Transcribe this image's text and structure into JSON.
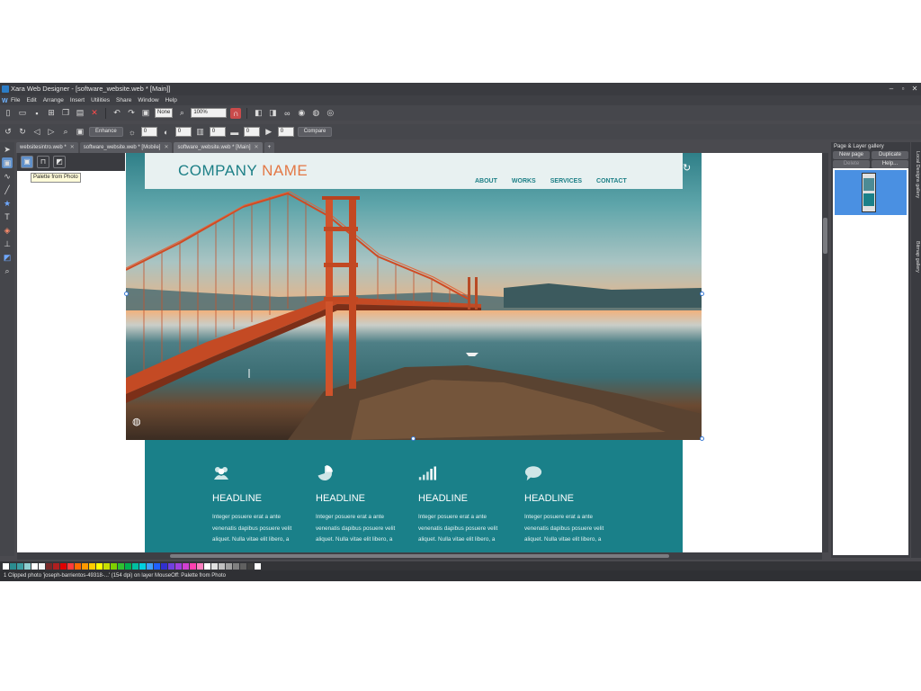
{
  "window": {
    "title": "Xara Web Designer - [software_website.web * [Main]]"
  },
  "menu": [
    "File",
    "Edit",
    "Arrange",
    "Insert",
    "Utilities",
    "Share",
    "Window",
    "Help"
  ],
  "toolbar": {
    "quality_select": "None",
    "zoom_select": "100%",
    "enhance_label": "Enhance",
    "compare_label": "Compare",
    "value_1": "0",
    "value_2": "0",
    "value_3": "0",
    "value_4": "0"
  },
  "tabs": [
    {
      "label": "websitesintro.web *"
    },
    {
      "label": "software_website.web * [Mobile]"
    },
    {
      "label": "software_website.web * [Main]"
    }
  ],
  "photo_tool": {
    "tooltip": "Palette from Photo"
  },
  "site": {
    "company_main": "COMPANY",
    "company_accent": "NAME",
    "nav": [
      "ABOUT",
      "WORKS",
      "SERVICES",
      "CONTACT"
    ],
    "features": [
      {
        "icon": "people-icon",
        "headline": "HEADLINE",
        "text": [
          "Integer posuere erat a ante",
          "venenatis dapibus posuere velit",
          "aliquet. Nulla vitae elit libero, a"
        ]
      },
      {
        "icon": "pie-chart-icon",
        "headline": "HEADLINE",
        "text": [
          "Integer posuere erat a ante",
          "venenatis dapibus posuere velit",
          "aliquet. Nulla vitae elit libero, a"
        ]
      },
      {
        "icon": "bar-chart-icon",
        "headline": "HEADLINE",
        "text": [
          "Integer posuere erat a ante",
          "venenatis dapibus posuere velit",
          "aliquet. Nulla vitae elit libero, a"
        ]
      },
      {
        "icon": "speech-bubble-icon",
        "headline": "HEADLINE",
        "text": [
          "Integer posuere erat a ante",
          "venenatis dapibus posuere velit",
          "aliquet. Nulla vitae elit libero, a"
        ]
      }
    ]
  },
  "gallery": {
    "title": "Page & Layer gallery",
    "new_page": "New page",
    "duplicate": "Duplicate",
    "delete": "Delete",
    "help": "Help...",
    "side_tabs": [
      "Local Designs gallery",
      "Bitmap gallery"
    ]
  },
  "status": "1 Clipped photo 'joseph-barrientos-49318-...' (154 dpi) on layer MouseOff: Palette from Photo",
  "colors": {
    "teal": "#1a8089",
    "accent": "#e37845",
    "swatches": [
      "#ffffff",
      "#2b8c8f",
      "#3c9ea2",
      "#8fcfd1",
      "#ffffff",
      "#f4f4f4",
      "#7a2828",
      "#b02020",
      "#e00000",
      "#ff3b3b",
      "#ff6a00",
      "#ff9900",
      "#ffcc00",
      "#ffff00",
      "#c8e000",
      "#80d000",
      "#30c030",
      "#00b050",
      "#00c0a0",
      "#00d0e0",
      "#40a0ff",
      "#2060ff",
      "#3030d0",
      "#7040e0",
      "#a040e0",
      "#d040d0",
      "#ff40b0",
      "#ff80c0",
      "#ffffff",
      "#e0e0e0",
      "#c0c0c0",
      "#a0a0a0",
      "#808080",
      "#606060",
      "#404040",
      "#ffffff"
    ]
  }
}
